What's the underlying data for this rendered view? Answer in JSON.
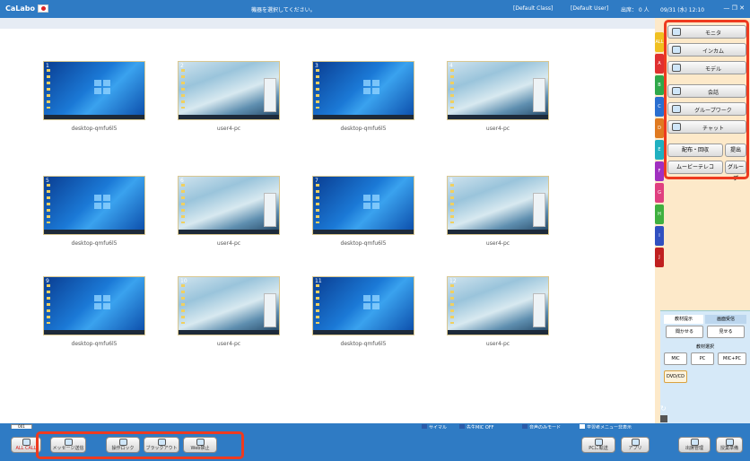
{
  "titlebar": {
    "brand": "CaLabo",
    "prompt": "機器を選択してください。",
    "class": "[Default Class]",
    "user": "[Default User]",
    "attendance": "出席： 0 人",
    "datetime": "09/31 (水) 12:10"
  },
  "tiles": [
    {
      "num": "1",
      "label": "desktop-qmfu6l5",
      "style": "win"
    },
    {
      "num": "2",
      "label": "user4-pc",
      "style": "wave"
    },
    {
      "num": "3",
      "label": "desktop-qmfu6l5",
      "style": "win"
    },
    {
      "num": "4",
      "label": "user4-pc",
      "style": "wave"
    },
    {
      "num": "5",
      "label": "desktop-qmfu6l5",
      "style": "win"
    },
    {
      "num": "6",
      "label": "user4-pc",
      "style": "wave"
    },
    {
      "num": "7",
      "label": "desktop-qmfu6l5",
      "style": "win"
    },
    {
      "num": "8",
      "label": "user4-pc",
      "style": "wave"
    },
    {
      "num": "9",
      "label": "desktop-qmfu6l5",
      "style": "win"
    },
    {
      "num": "10",
      "label": "user4-pc",
      "style": "wave"
    },
    {
      "num": "11",
      "label": "desktop-qmfu6l5",
      "style": "win"
    },
    {
      "num": "12",
      "label": "user4-pc",
      "style": "wave"
    }
  ],
  "group_strip": [
    {
      "label": "ALL",
      "color": "#f0c020"
    },
    {
      "label": "A",
      "color": "#e03030"
    },
    {
      "label": "B",
      "color": "#2fa84a"
    },
    {
      "label": "C",
      "color": "#2a6fd0"
    },
    {
      "label": "D",
      "color": "#e07a20"
    },
    {
      "label": "E",
      "color": "#20b0c0"
    },
    {
      "label": "F",
      "color": "#a030c0"
    },
    {
      "label": "G",
      "color": "#e04080"
    },
    {
      "label": "H",
      "color": "#3fb03f"
    },
    {
      "label": "I",
      "color": "#3050c0"
    },
    {
      "label": "J",
      "color": "#c02020"
    }
  ],
  "menu": {
    "monitor": "モニタ",
    "intercom": "インカム",
    "model": "モデル",
    "conversation": "会話",
    "groupwork": "グループワーク",
    "chat": "チャット",
    "distribute": "配布・回収",
    "submit": "提出",
    "movie": "ムービーテレコ",
    "group": "グループ"
  },
  "lower_panel": {
    "tab_material": "教材提示",
    "tab_screen": "画面受信",
    "listen": "聞かせる",
    "show": "見せる",
    "material_select": "教材選択",
    "mic": "MIC",
    "pc": "PC",
    "micpc": "MIC+PC",
    "dvd": "DVD/CD"
  },
  "status": {
    "tab": "001",
    "sleep": "サイマル",
    "teacher_mic": "先生MIC OFF",
    "voice_mode": "音声のみモード",
    "student_menu": "学習者メニュー非表示"
  },
  "bottom_left": [
    {
      "label": "ALL CALL"
    },
    {
      "label": "メッセージ送信"
    },
    {
      "label": "操作ロック"
    },
    {
      "label": "ブラックアウト"
    },
    {
      "label": "Web禁止"
    }
  ],
  "bottom_right": [
    {
      "label": "PCに転送"
    },
    {
      "label": "アプリ"
    },
    {
      "label": "出席管理"
    },
    {
      "label": "授業準備"
    }
  ],
  "colors": {
    "accent": "#2f7bc4",
    "highlight": "#ee3a1f",
    "side_bg": "#fde9c9"
  }
}
